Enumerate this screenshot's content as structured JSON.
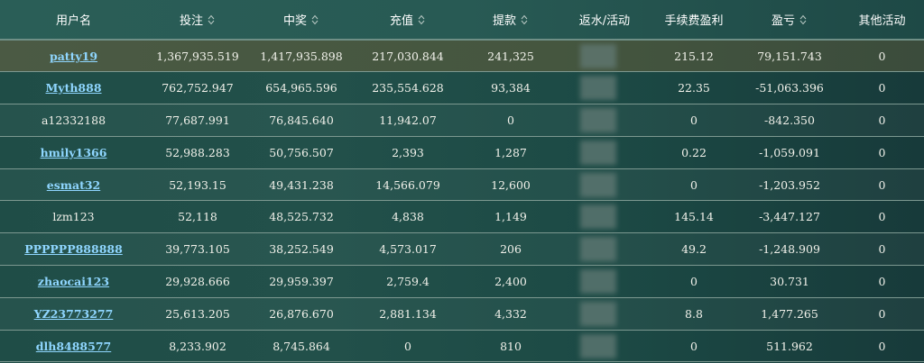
{
  "columns": [
    {
      "label": "用户名",
      "sortable": false
    },
    {
      "label": "投注",
      "sortable": true
    },
    {
      "label": "中奖",
      "sortable": true
    },
    {
      "label": "充值",
      "sortable": true
    },
    {
      "label": "提款",
      "sortable": true
    },
    {
      "label": "返水/活动",
      "sortable": false
    },
    {
      "label": "手续费盈利",
      "sortable": false
    },
    {
      "label": "盈亏",
      "sortable": true
    },
    {
      "label": "其他活动",
      "sortable": false
    }
  ],
  "rows": [
    {
      "user": "patty19",
      "linked": true,
      "bet": "1,367,935.519",
      "win": "1,417,935.898",
      "deposit": "217,030.844",
      "withdraw": "241,325",
      "fee": "215.12",
      "profit": "79,151.743",
      "other": "0"
    },
    {
      "user": "Myth888",
      "linked": true,
      "bet": "762,752.947",
      "win": "654,965.596",
      "deposit": "235,554.628",
      "withdraw": "93,384",
      "fee": "22.35",
      "profit": "-51,063.396",
      "other": "0"
    },
    {
      "user": "a12332188",
      "linked": false,
      "bet": "77,687.991",
      "win": "76,845.640",
      "deposit": "11,942.07",
      "withdraw": "0",
      "fee": "0",
      "profit": "-842.350",
      "other": "0"
    },
    {
      "user": "hmily1366",
      "linked": true,
      "bet": "52,988.283",
      "win": "50,756.507",
      "deposit": "2,393",
      "withdraw": "1,287",
      "fee": "0.22",
      "profit": "-1,059.091",
      "other": "0"
    },
    {
      "user": "esmat32",
      "linked": true,
      "bet": "52,193.15",
      "win": "49,431.238",
      "deposit": "14,566.079",
      "withdraw": "12,600",
      "fee": "0",
      "profit": "-1,203.952",
      "other": "0"
    },
    {
      "user": "lzm123",
      "linked": false,
      "bet": "52,118",
      "win": "48,525.732",
      "deposit": "4,838",
      "withdraw": "1,149",
      "fee": "145.14",
      "profit": "-3,447.127",
      "other": "0"
    },
    {
      "user": "PPPPPP888888",
      "linked": true,
      "bet": "39,773.105",
      "win": "38,252.549",
      "deposit": "4,573.017",
      "withdraw": "206",
      "fee": "49.2",
      "profit": "-1,248.909",
      "other": "0"
    },
    {
      "user": "zhaocai123",
      "linked": true,
      "bet": "29,928.666",
      "win": "29,959.397",
      "deposit": "2,759.4",
      "withdraw": "2,400",
      "fee": "0",
      "profit": "30.731",
      "other": "0"
    },
    {
      "user": "YZ23773277",
      "linked": true,
      "bet": "25,613.205",
      "win": "26,876.670",
      "deposit": "2,881.134",
      "withdraw": "4,332",
      "fee": "8.8",
      "profit": "1,477.265",
      "other": "0"
    },
    {
      "user": "dlh8488577",
      "linked": true,
      "bet": "8,233.902",
      "win": "8,745.864",
      "deposit": "0",
      "withdraw": "810",
      "fee": "0",
      "profit": "511.962",
      "other": "0"
    }
  ],
  "colors": {
    "link": "#8fd6ff",
    "text": "#f1f1ea",
    "header_text": "#ffffff",
    "first_row_bg": "#4b5a44"
  },
  "icons": {
    "sort": "sort-caret-icon"
  }
}
